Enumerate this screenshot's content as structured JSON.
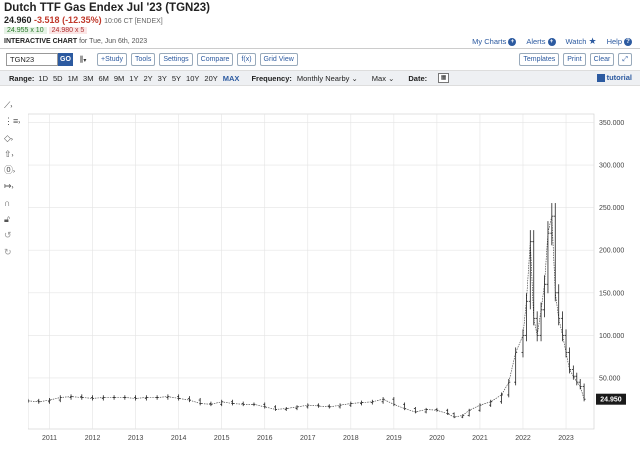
{
  "header": {
    "title": "Dutch TTF Gas Endex Jul '23 (TGN23)",
    "last": "24.960",
    "change": "-3.518 (-12.35%)",
    "time": "10:06 CT [ENDEX]",
    "bid": "24.955 x 10",
    "ask": "24.980 x 5",
    "chart_label": "INTERACTIVE CHART",
    "chart_for": "for Tue, Jun 6th, 2023"
  },
  "top_links": {
    "my_charts": "My Charts",
    "alerts": "Alerts",
    "watch": "Watch",
    "help": "Help"
  },
  "toolbar": {
    "symbol": "TGN23",
    "go": "GO",
    "study": "+Study",
    "tools": "Tools",
    "settings": "Settings",
    "compare": "Compare",
    "fx": "f(x)",
    "grid_view": "Grid View",
    "templates": "Templates",
    "print": "Print",
    "clear": "Clear",
    "expand": "⤢"
  },
  "range_bar": {
    "label": "Range:",
    "ranges": [
      "1D",
      "5D",
      "1M",
      "3M",
      "6M",
      "9M",
      "1Y",
      "2Y",
      "3Y",
      "5Y",
      "10Y",
      "20Y",
      "MAX"
    ],
    "selected": "MAX",
    "frequency_label": "Frequency:",
    "frequency_value": "Monthly Nearby",
    "max_value": "Max",
    "date_label": "Date:",
    "tutorial": "tutorial"
  },
  "colors": {
    "accent": "#2c5aa0",
    "negative": "#c0392b",
    "price_tag": "#1a1a1a"
  },
  "chart_data": {
    "type": "line",
    "x_ticks": [
      "2011",
      "2012",
      "2013",
      "2014",
      "2015",
      "2016",
      "2017",
      "2018",
      "2019",
      "2020",
      "2021",
      "2022",
      "2023"
    ],
    "y_ticks": [
      "50.000",
      "100.000",
      "150.000",
      "200.000",
      "250.000",
      "300.000",
      "350.000"
    ],
    "ylim": [
      -10,
      360
    ],
    "current_price_tag": "24.950",
    "grid": true,
    "series": [
      {
        "x": [
          2010.5,
          2010.75,
          2011,
          2011.25,
          2011.5,
          2011.75,
          2012,
          2012.25,
          2012.5,
          2012.75,
          2013,
          2013.25,
          2013.5,
          2013.75,
          2014,
          2014.25,
          2014.5,
          2014.75,
          2015,
          2015.25,
          2015.5,
          2015.75,
          2016,
          2016.25,
          2016.5,
          2016.75,
          2017,
          2017.25,
          2017.5,
          2017.75,
          2018,
          2018.25,
          2018.5,
          2018.75,
          2019,
          2019.25,
          2019.5,
          2019.75,
          2020,
          2020.25,
          2020.4,
          2020.6,
          2020.75,
          2021,
          2021.25,
          2021.5,
          2021.67,
          2021.83,
          2022,
          2022.08,
          2022.17,
          2022.25,
          2022.33,
          2022.42,
          2022.5,
          2022.58,
          2022.67,
          2022.75,
          2022.83,
          2022.92,
          2023,
          2023.08,
          2023.17,
          2023.25,
          2023.33,
          2023.42
        ],
        "y": [
          23,
          22,
          24,
          27,
          28,
          27,
          26,
          27,
          27,
          27,
          26,
          27,
          27,
          28,
          26,
          24,
          20,
          19,
          22,
          20,
          19,
          19,
          16,
          13,
          14,
          16,
          18,
          17,
          16,
          18,
          20,
          21,
          22,
          25,
          19,
          14,
          10,
          13,
          12,
          8,
          4,
          6,
          12,
          18,
          22,
          30,
          45,
          80,
          100,
          140,
          210,
          120,
          100,
          130,
          160,
          220,
          240,
          150,
          120,
          100,
          80,
          60,
          52,
          45,
          40,
          25
        ]
      }
    ]
  }
}
